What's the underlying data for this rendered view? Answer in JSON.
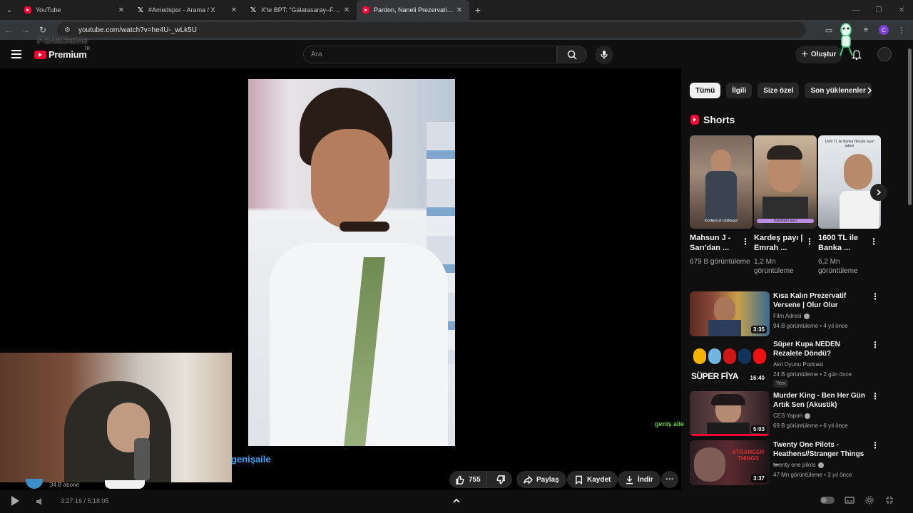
{
  "browser": {
    "tabs": [
      {
        "title": "YouTube",
        "icon": "youtube-icon",
        "active": false
      },
      {
        "title": "#Amedspor - Arama / X",
        "icon": "x-icon",
        "active": false
      },
      {
        "title": "X'te BPT: \"Galatasaray–Fenerba",
        "icon": "x-icon",
        "active": false
      },
      {
        "title": "Pardon, Naneli Prezervatif Var M",
        "icon": "youtube-icon",
        "active": true
      }
    ],
    "url": "youtube.com/watch?v=he4U-_wLk5U",
    "profile_initial": "C"
  },
  "masthead": {
    "logo_text": "Premium",
    "logo_country": "TR",
    "overlay_logo": "PuNaGame",
    "search_placeholder": "Ara",
    "create_label": "Oluştur"
  },
  "player": {
    "channel_link": "genişaile",
    "watermark": "geniş aile",
    "subscribers": "34 B abone",
    "likes": "755",
    "share_label": "Paylaş",
    "save_label": "Kaydet",
    "download_label": "İndir",
    "time": "3:27:16 / 5:18:05"
  },
  "sidebar": {
    "chips": [
      "Tümü",
      "İlgili",
      "Size özel",
      "Son yüklenenler"
    ],
    "shorts_title": "Shorts",
    "shorts": [
      {
        "title": "Mahsun J - Sarı'dan ...",
        "views": "679 B görüntüleme",
        "overlay": "inceliyorum ufaktaşıc"
      },
      {
        "title": "Kardeş payı | Emrah ...",
        "views": "1,2 Mn görüntüleme",
        "overlay": "Kardeşim payı"
      },
      {
        "title": "1600 TL ile Banka ...",
        "views": "6,2 Mn görüntüleme",
        "overlay": "1600 TL ile Banka Hesabı açan adam"
      }
    ],
    "recommendations": [
      {
        "title": "Kısa Kalın Prezervatif Versene | Olur Olur",
        "channel": "Film Adresi",
        "verified": true,
        "meta": "94 B görüntüleme • 4 yıl önce",
        "duration": "3:35",
        "badge": ""
      },
      {
        "title": "Süper Kupa NEDEN Rezalete Döndü?",
        "channel": "Akıl Oyunu Podcast",
        "verified": false,
        "meta": "24 B görüntüleme • 2 gün önce",
        "duration": "16:40",
        "badge": "Yeni",
        "thumb_text": "SÜPER FİYA"
      },
      {
        "title": "Murder King - Ben Her Gün Artık Sen (Akustik)",
        "channel": "CES Yapım",
        "verified": true,
        "meta": "69 B görüntüleme • 6 yıl önce",
        "duration": "5:03",
        "badge": ""
      },
      {
        "title": "Twenty One Pilots - Heathens//Stranger Things ...",
        "channel": "twenty one pilots",
        "verified": true,
        "meta": "47 Mn görüntüleme • 3 yıl önce",
        "duration": "3:37",
        "badge": "",
        "thumb_text": "STRANGER THINGS"
      }
    ]
  },
  "colors": {
    "background": "#0f0f0f",
    "youtube_red": "#ff0033",
    "link_blue": "#3ea6ff",
    "chip_bg": "#272727"
  }
}
